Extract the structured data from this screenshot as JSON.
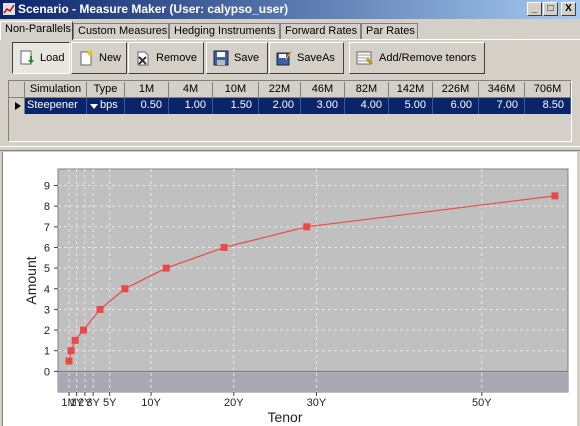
{
  "window": {
    "title": "Scenario - Measure Maker (User: calypso_user)",
    "minimize": "_",
    "maximize": "□",
    "close": "X"
  },
  "tabs": [
    {
      "label": "Non-Parallels",
      "active": true
    },
    {
      "label": "Custom Measures",
      "active": false
    },
    {
      "label": "Hedging Instruments",
      "active": false
    },
    {
      "label": "Forward Rates",
      "active": false
    },
    {
      "label": "Par Rates",
      "active": false
    }
  ],
  "toolbar": {
    "load": "Load",
    "new": "New",
    "remove": "Remove",
    "save": "Save",
    "saveas": "SaveAs",
    "add_remove_tenors": "Add/Remove tenors"
  },
  "table": {
    "headers": [
      "Simulation",
      "Type",
      "1M",
      "4M",
      "10M",
      "22M",
      "46M",
      "82M",
      "142M",
      "226M",
      "346M",
      "706M"
    ],
    "rows": [
      {
        "simulation": "Steepener",
        "type": "bps",
        "values": [
          "0.50",
          "1.00",
          "1.50",
          "2.00",
          "3.00",
          "4.00",
          "5.00",
          "6.00",
          "7.00",
          "8.50"
        ]
      }
    ]
  },
  "chart_data": {
    "type": "line",
    "xlabel": "Tenor",
    "ylabel": "Amount",
    "x_months": [
      1,
      4,
      10,
      22,
      46,
      82,
      142,
      226,
      346,
      706
    ],
    "series": [
      {
        "values": [
          0.5,
          1.0,
          1.5,
          2.0,
          3.0,
          4.0,
          5.0,
          6.0,
          7.0,
          8.5
        ]
      }
    ],
    "ylim": [
      -1.0,
      9.8
    ],
    "yticks": [
      0,
      1,
      2,
      3,
      4,
      5,
      6,
      7,
      8,
      9
    ],
    "xticks": [
      {
        "label": "1M",
        "months": 1
      },
      {
        "label": "1Y",
        "months": 12
      },
      {
        "label": "2Y",
        "months": 24
      },
      {
        "label": "3Y",
        "months": 36
      },
      {
        "label": "5Y",
        "months": 60
      },
      {
        "label": "10Y",
        "months": 120
      },
      {
        "label": "20Y",
        "months": 240
      },
      {
        "label": "30Y",
        "months": 360
      },
      {
        "label": "50Y",
        "months": 600
      }
    ],
    "grid": true,
    "colors": {
      "line": "#e84a4a",
      "marker": "#e84a4a",
      "plot_bg": "#c0c0c0",
      "lower_band": "#a9a9b4"
    }
  }
}
